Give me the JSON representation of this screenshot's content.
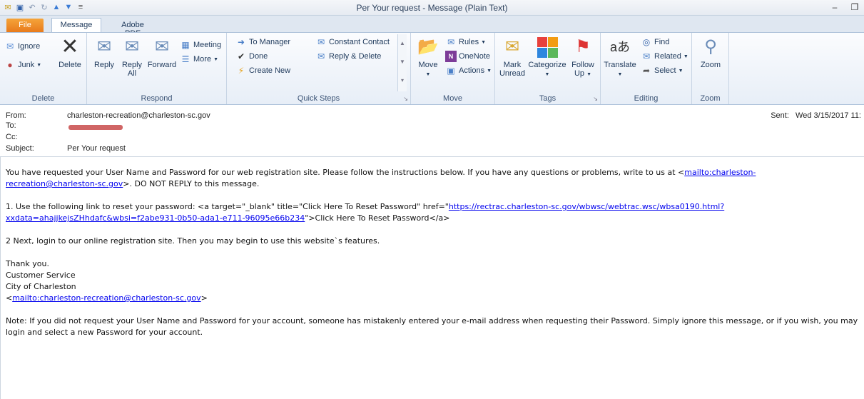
{
  "window": {
    "title": "Per Your request  -  Message (Plain Text)",
    "controls": [
      "minimize-icon",
      "restore-icon"
    ]
  },
  "qat": [
    "envelope-icon",
    "save-icon",
    "undo-icon",
    "redo-icon",
    "up-arrow-icon",
    "down-arrow-icon",
    "customize-icon"
  ],
  "tabs": {
    "file": "File",
    "message": "Message",
    "pdf": "Adobe PDF"
  },
  "ribbon": {
    "delete": {
      "label": "Delete",
      "ignore": "Ignore",
      "junk": "Junk",
      "delete_btn": "Delete"
    },
    "respond": {
      "label": "Respond",
      "reply": "Reply",
      "reply_all_1": "Reply",
      "reply_all_2": "All",
      "forward": "Forward",
      "meeting": "Meeting",
      "more": "More"
    },
    "quick_steps": {
      "label": "Quick Steps",
      "to_manager": "To Manager",
      "done": "Done",
      "create_new": "Create New",
      "constant_contact": "Constant Contact",
      "reply_delete": "Reply & Delete"
    },
    "move": {
      "label": "Move",
      "move_btn": "Move",
      "rules": "Rules",
      "onenote": "OneNote",
      "actions": "Actions"
    },
    "tags": {
      "label": "Tags",
      "mark_unread_1": "Mark",
      "mark_unread_2": "Unread",
      "categorize": "Categorize",
      "follow_up_1": "Follow",
      "follow_up_2": "Up"
    },
    "editing": {
      "label": "Editing",
      "translate": "Translate",
      "find": "Find",
      "related": "Related",
      "select": "Select"
    },
    "zoom": {
      "label": "Zoom",
      "zoom_btn": "Zoom"
    }
  },
  "header": {
    "from_label": "From:",
    "from_value": "charleston-recreation@charleston-sc.gov",
    "to_label": "To:",
    "cc_label": "Cc:",
    "subject_label": "Subject:",
    "subject_value": "Per Your request",
    "sent_label": "Sent:",
    "sent_value": "Wed 3/15/2017 11:"
  },
  "body": {
    "p1_text": "You have requested your User Name and Password for our web registration site. Please follow the instructions below. If you have any questions or problems, write to us at <",
    "p1_link_a": "mailto:charleston-",
    "p1_link_b": "recreation@charleston-sc.gov",
    "p1_end": ">. DO NOT REPLY to this message.",
    "p2_text": "1. Use the following link to reset your password: <a target=\"_blank\" title=\"Click Here To Reset Password\" href=\"",
    "p2_link_a": "https://rectrac.charleston-sc.gov/wbwsc/webtrac.wsc/wbsa0190.html?",
    "p2_link_b": "xxdata=ahajjkejsZHhdafc&wbsi=f2abe931-0b50-ada1-e711-96095e66b234",
    "p2_end": "\">Click Here To Reset Password</a>",
    "p3": "2  Next, login to our online registration site.  Then you may begin to use this website`s features.",
    "sig1": "Thank you.",
    "sig2": "Customer Service",
    "sig3": "City of Charleston",
    "sig4_open": "<",
    "sig4_link": "mailto:charleston-recreation@charleston-sc.gov",
    "sig4_close": ">",
    "note": "Note: If you did not request your User Name and Password for your account, someone has mistakenly entered your e-mail address when requesting their Password. Simply ignore this message, or if you wish, you may login and select a new Password for your account."
  }
}
